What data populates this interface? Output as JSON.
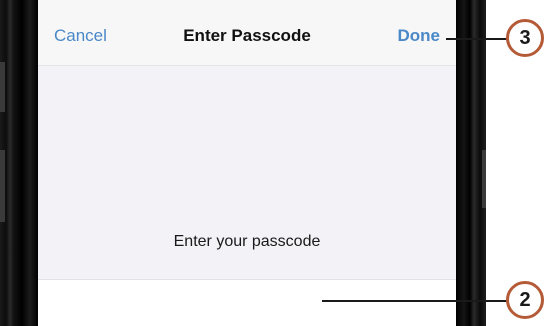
{
  "navbar": {
    "cancel_label": "Cancel",
    "title": "Enter Passcode",
    "done_label": "Done"
  },
  "prompt": {
    "text": "Enter your passcode"
  },
  "passcode_field": {
    "value": ""
  },
  "callouts": {
    "done": "3",
    "field": "2"
  },
  "colors": {
    "link_blue": "#4a88c7",
    "callout_ring": "#b55a36",
    "screen_background": "#f2f2f7"
  }
}
